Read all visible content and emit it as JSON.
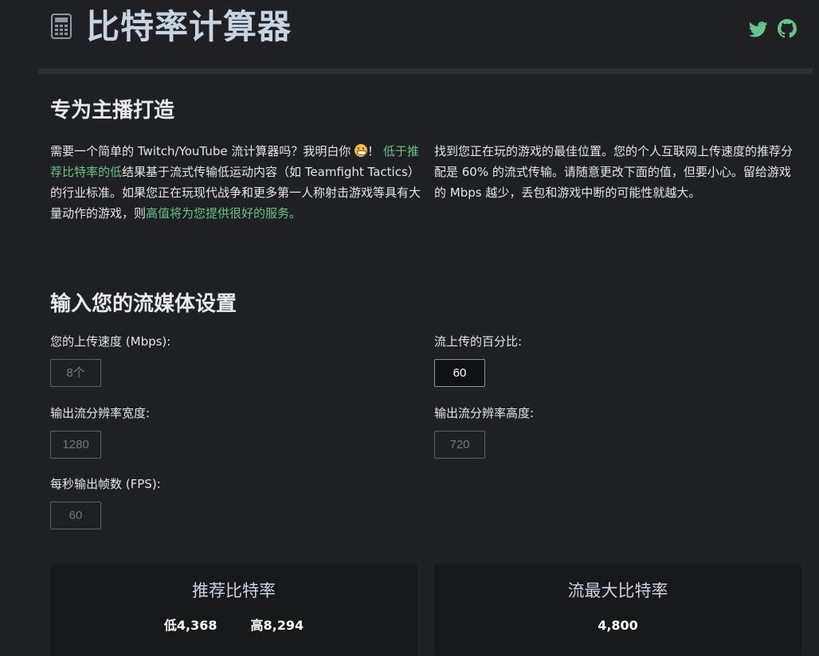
{
  "header": {
    "title": "比特率计算器",
    "logo_icon": "calculator-icon",
    "social_icons": [
      "twitter-icon",
      "github-icon"
    ],
    "accent_color": "#66c48a"
  },
  "intro": {
    "heading": "专为主播打造",
    "left": {
      "part1": "需要一个简单的 Twitch/YouTube 流计算器吗？我明白你",
      "part2": "！",
      "link1": "低于推荐比特率的低",
      "part3": "结果基于流式传输低运动内容（如 Teamfight Tactics）的行业标准。如果您正在玩现代战争和更多第一人称射击游戏等具有大量动作的游戏，则",
      "link2": "高值将为您提供很好的服务。"
    },
    "right": "找到您正在玩的游戏的最佳位置。您的个人互联网上传速度的推荐分配是 60% 的流式传输。请随意更改下面的值，但要小心。留给游戏的 Mbps 越少，丢包和游戏中断的可能性就越大。"
  },
  "settings": {
    "heading": "输入您的流媒体设置",
    "upload_label": "您的上传速度 (Mbps):",
    "upload_placeholder": "8个",
    "percent_label": "流上传的百分比:",
    "percent_value": "60",
    "width_label": "输出流分辨率宽度:",
    "width_placeholder": "1280",
    "height_label": "输出流分辨率高度:",
    "height_placeholder": "720",
    "fps_label": "每秒输出帧数 (FPS):",
    "fps_placeholder": "60"
  },
  "results": {
    "recommended": {
      "title": "推荐比特率",
      "low": "低4,368",
      "high": "高8,294"
    },
    "max": {
      "title": "流最大比特率",
      "value": "4,800"
    }
  }
}
